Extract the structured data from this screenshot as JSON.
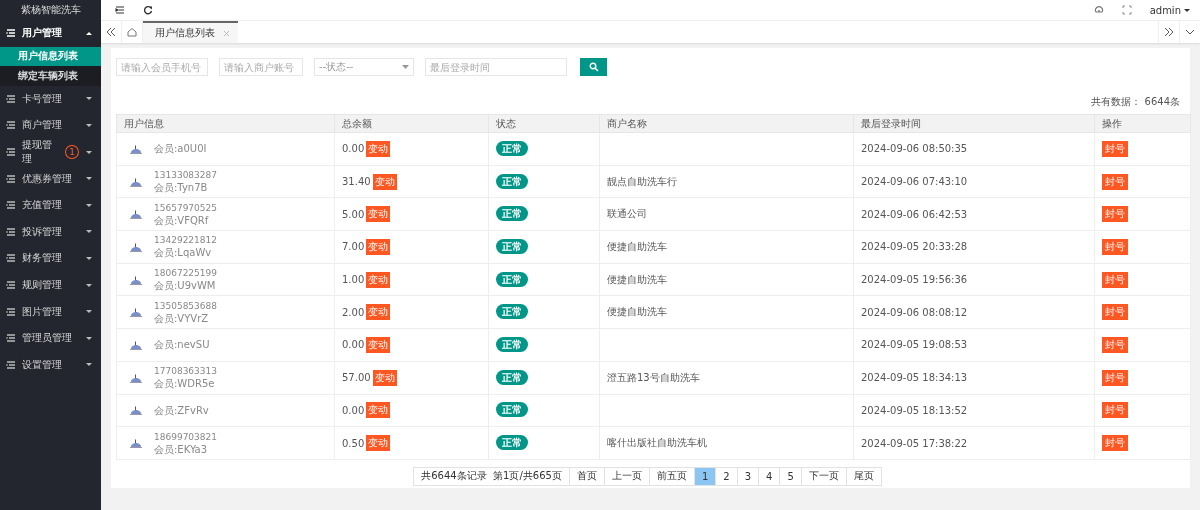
{
  "sidebar": {
    "title": "紫杨智能洗车",
    "items": [
      {
        "label": "用户管理",
        "expanded": true,
        "children": [
          {
            "label": "用户信息列表",
            "selected": true
          },
          {
            "label": "绑定车辆列表",
            "selected": false
          }
        ]
      },
      {
        "label": "卡号管理",
        "expanded": false
      },
      {
        "label": "商户管理",
        "expanded": false
      },
      {
        "label": "提现管理",
        "expanded": false,
        "badge": "1"
      },
      {
        "label": "优惠券管理",
        "expanded": false
      },
      {
        "label": "充值管理",
        "expanded": false
      },
      {
        "label": "投诉管理",
        "expanded": false
      },
      {
        "label": "财务管理",
        "expanded": false
      },
      {
        "label": "规则管理",
        "expanded": false
      },
      {
        "label": "图片管理",
        "expanded": false
      },
      {
        "label": "管理员管理",
        "expanded": false
      },
      {
        "label": "设置管理",
        "expanded": false
      }
    ]
  },
  "header": {
    "user": "admin"
  },
  "tabs": [
    {
      "label": "用户信息列表",
      "selected": true
    }
  ],
  "filters": {
    "phone": {
      "placeholder": "请输入会员手机号"
    },
    "merchant": {
      "placeholder": "请输入商户账号"
    },
    "status": {
      "placeholder": "--状态--"
    },
    "login_time": {
      "placeholder": "最后登录时间"
    }
  },
  "total": "共有数据： 6644条",
  "table": {
    "columns": [
      "用户信息",
      "总余额",
      "状态",
      "商户名称",
      "最后登录时间",
      "操作"
    ],
    "rows": [
      {
        "phone": "",
        "nickname": "会员:a0U0I",
        "balance": "0.00",
        "adjust": "变动",
        "status": "正常",
        "merchant": "",
        "last_login": "2024-09-06 08:50:35",
        "action": "封号"
      },
      {
        "phone": "13133083287",
        "nickname": "会员:Tyn7B",
        "balance": "31.40",
        "adjust": "变动",
        "status": "正常",
        "merchant": "靓点自助洗车行",
        "last_login": "2024-09-06 07:43:10",
        "action": "封号"
      },
      {
        "phone": "15657970525",
        "nickname": "会员:VFQRf",
        "balance": "5.00",
        "adjust": "变动",
        "status": "正常",
        "merchant": "联通公司",
        "last_login": "2024-09-06 06:42:53",
        "action": "封号"
      },
      {
        "phone": "13429221812",
        "nickname": "会员:LqaWv",
        "balance": "7.00",
        "adjust": "变动",
        "status": "正常",
        "merchant": "便捷自助洗车",
        "last_login": "2024-09-05 20:33:28",
        "action": "封号"
      },
      {
        "phone": "18067225199",
        "nickname": "会员:U9vWM",
        "balance": "1.00",
        "adjust": "变动",
        "status": "正常",
        "merchant": "便捷自助洗车",
        "last_login": "2024-09-05 19:56:36",
        "action": "封号"
      },
      {
        "phone": "13505853688",
        "nickname": "会员:VYVrZ",
        "balance": "2.00",
        "adjust": "变动",
        "status": "正常",
        "merchant": "便捷自助洗车",
        "last_login": "2024-09-06 08:08:12",
        "action": "封号"
      },
      {
        "phone": "",
        "nickname": "会员:nevSU",
        "balance": "0.00",
        "adjust": "变动",
        "status": "正常",
        "merchant": "",
        "last_login": "2024-09-05 19:08:53",
        "action": "封号"
      },
      {
        "phone": "17708363313",
        "nickname": "会员:WDR5e",
        "balance": "57.00",
        "adjust": "变动",
        "status": "正常",
        "merchant": "澄五路13号自助洗车",
        "last_login": "2024-09-05 18:34:13",
        "action": "封号"
      },
      {
        "phone": "",
        "nickname": "会员:ZFvRv",
        "balance": "0.00",
        "adjust": "变动",
        "status": "正常",
        "merchant": "",
        "last_login": "2024-09-05 18:13:52",
        "action": "封号"
      },
      {
        "phone": "18699703821",
        "nickname": "会员:EKYa3",
        "balance": "0.50",
        "adjust": "变动",
        "status": "正常",
        "merchant": "喀什出版社自助洗车机",
        "last_login": "2024-09-05 17:38:22",
        "action": "封号"
      }
    ]
  },
  "pagination": {
    "summary": "共6644条记录  第1页/共665页",
    "first": "首页",
    "prev": "上一页",
    "prev_five": "前五页",
    "pages": [
      {
        "label": "1",
        "selected": true
      },
      {
        "label": "2",
        "selected": false
      },
      {
        "label": "3",
        "selected": false
      },
      {
        "label": "4",
        "selected": false
      },
      {
        "label": "5",
        "selected": false
      }
    ],
    "next": "下一页",
    "last": "尾页"
  }
}
